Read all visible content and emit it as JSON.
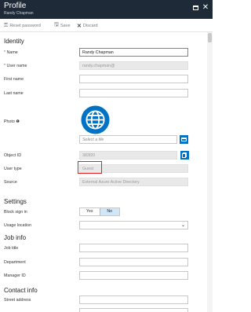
{
  "window": {
    "title": "Profile",
    "subtitle": "Randy Chapman",
    "maximize_icon": "maximize-icon",
    "close_icon": "close-icon",
    "close_glyph": "✕"
  },
  "toolbar": {
    "reset_password": "Reset password",
    "save": "Save",
    "discard": "Discard",
    "icons": {
      "reset": "key-icon",
      "save": "save-icon",
      "discard": "x-icon"
    }
  },
  "sections": {
    "identity": "Identity",
    "settings": "Settings",
    "job_info": "Job info",
    "contact_info": "Contact info"
  },
  "identity": {
    "name_label": "Name",
    "name_value": "Randy Chapman",
    "required_mark": "*",
    "user_name_label": "User name",
    "user_name_value": "randy.chapman@",
    "first_name_label": "First name",
    "first_name_value": "",
    "last_name_label": "Last name",
    "last_name_value": "",
    "photo_label": "Photo",
    "photo_info_glyph": "❶",
    "photo_placeholder": "Select a file",
    "object_id_label": "Object ID",
    "object_id_value": "383f20",
    "user_type_label": "User type",
    "user_type_value": "Guest",
    "source_label": "Source",
    "source_value": "External Azure Active Directory"
  },
  "settings": {
    "block_sign_in_label": "Block sign in",
    "yes": "Yes",
    "no": "No",
    "selected": "No",
    "usage_location_label": "Usage location",
    "usage_location_value": ""
  },
  "job_info": {
    "job_title_label": "Job title",
    "department_label": "Department",
    "manager_id_label": "Manager ID"
  },
  "contact_info": {
    "street_address_label": "Street address"
  },
  "colors": {
    "titlebar": "#1f2a38",
    "accent": "#0072c6",
    "focus_border": "#5aa05a",
    "highlight": "#dd2222",
    "toggle_selected": "#cfe7f8"
  }
}
